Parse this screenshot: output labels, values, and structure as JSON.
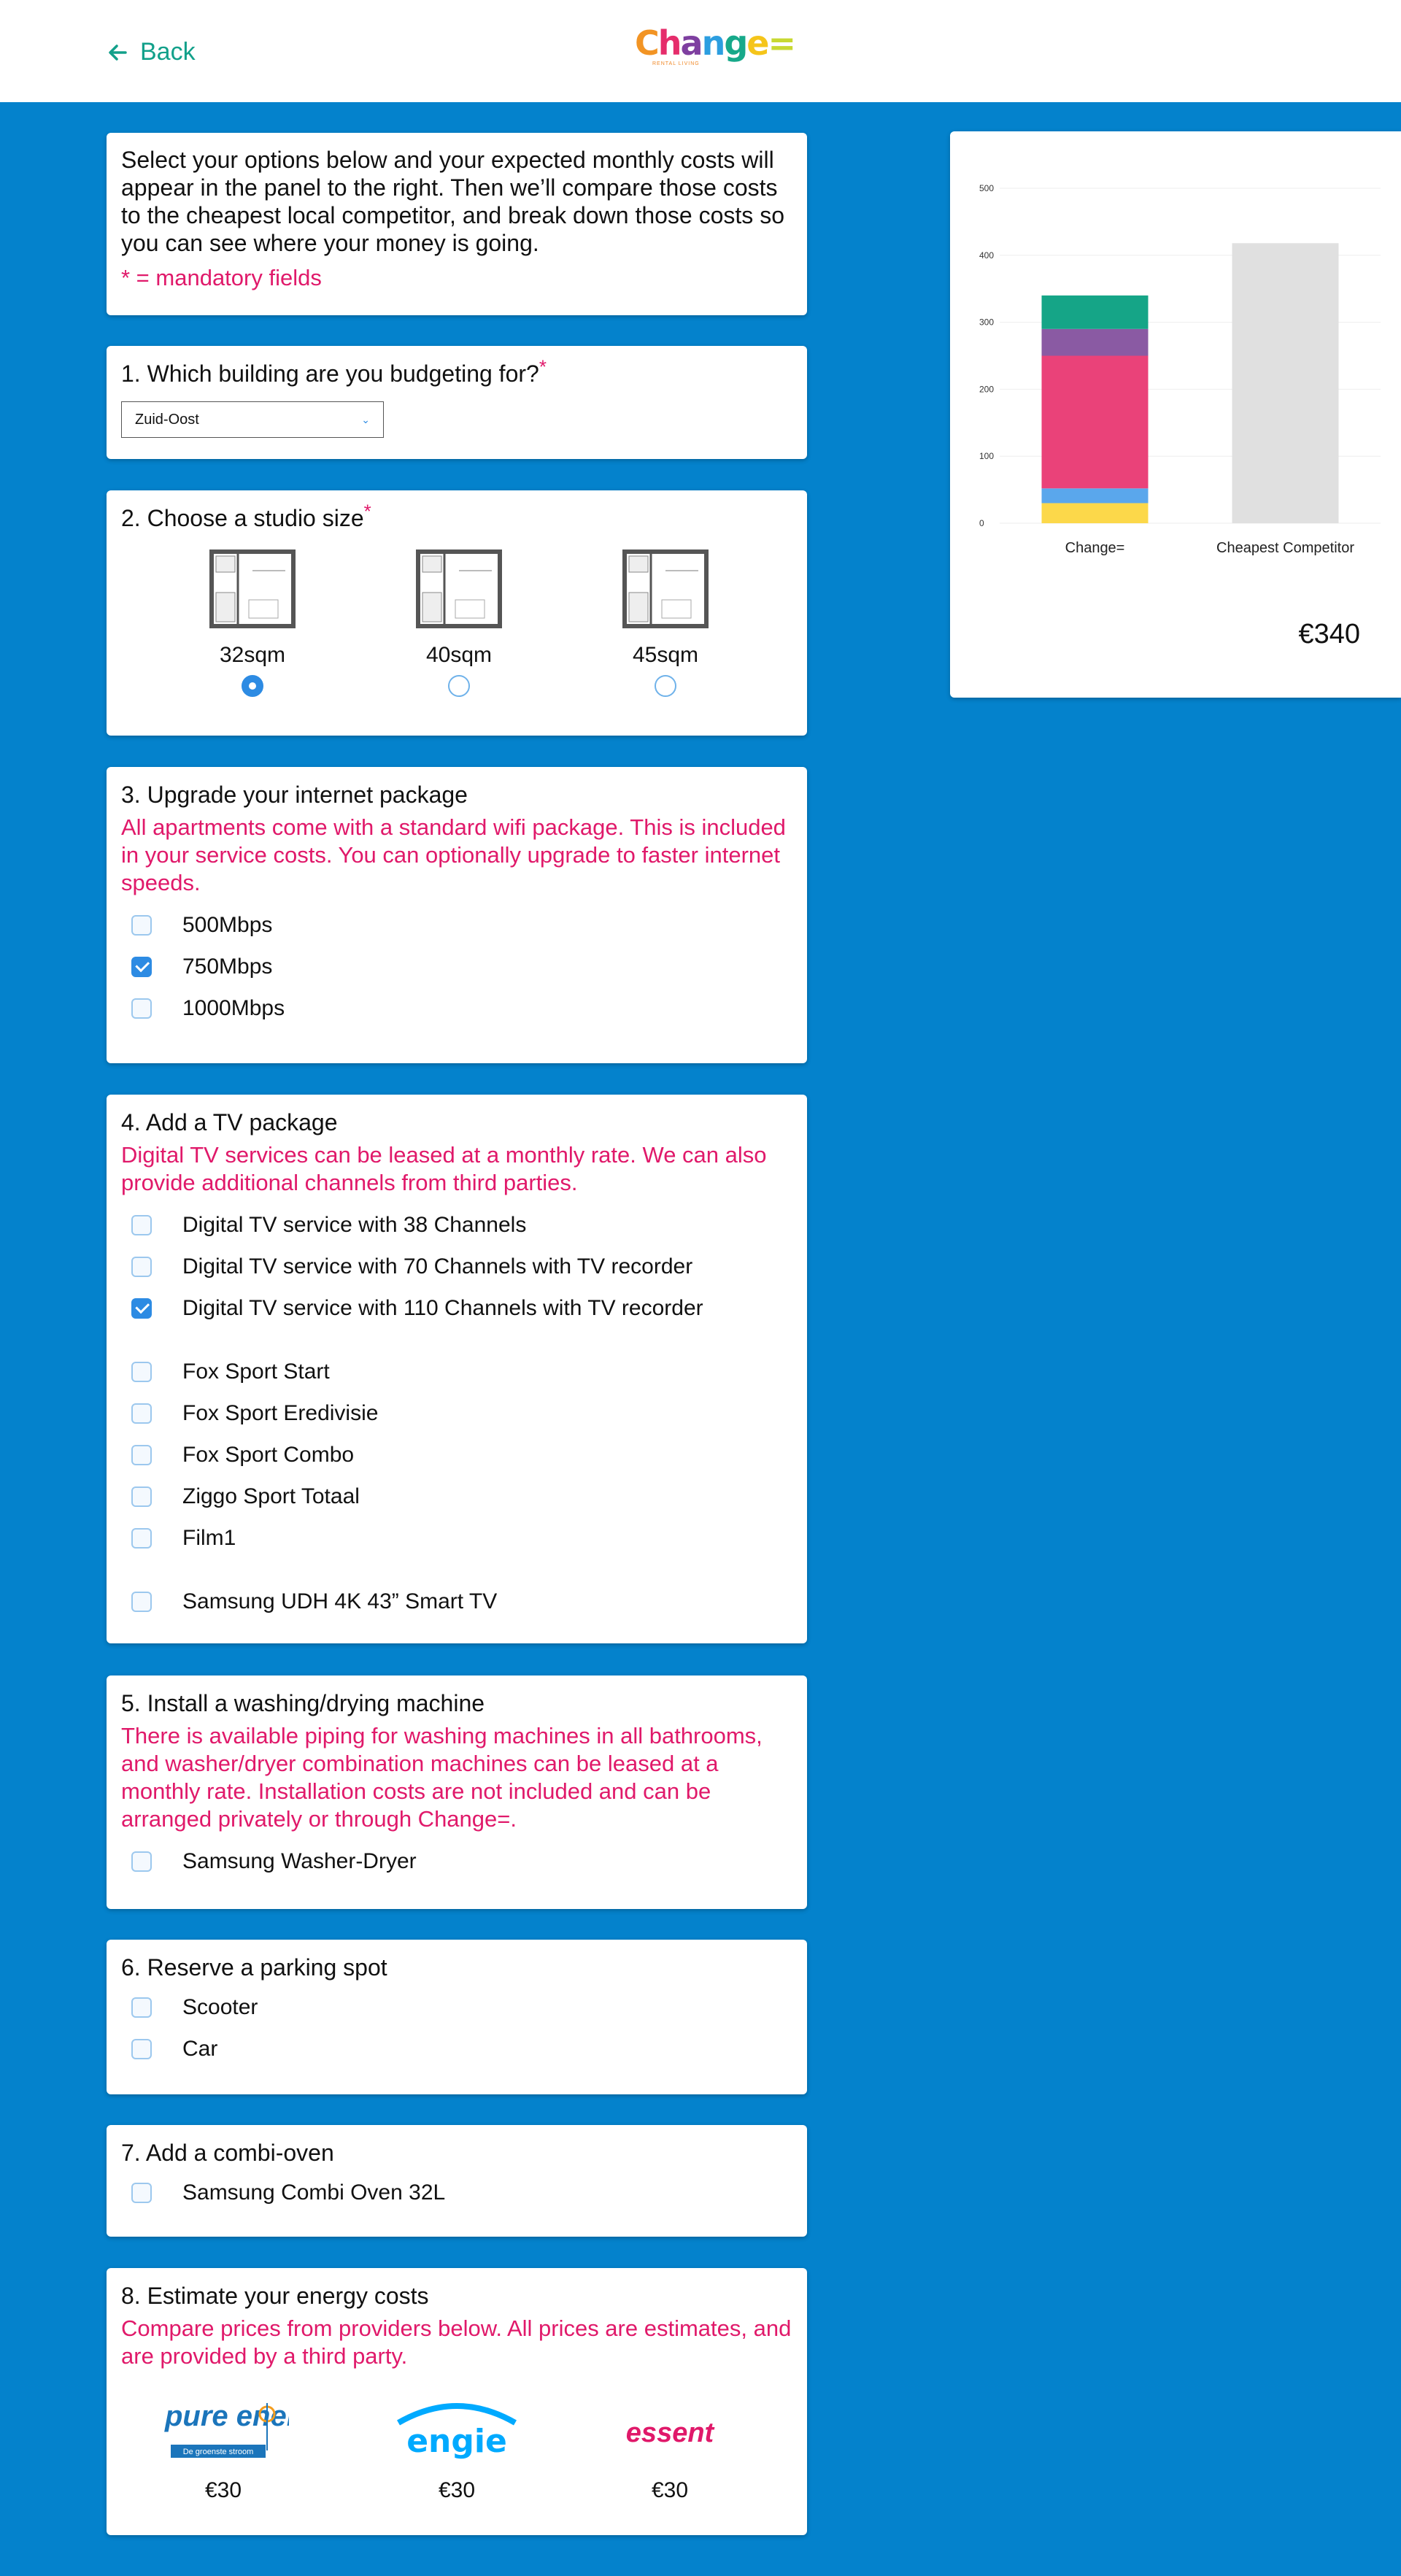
{
  "header": {
    "back_label": "Back",
    "logo_text": "Change=",
    "logo_subtitle": "RENTAL LIVING"
  },
  "intro": {
    "text": "Select your options below and your expected monthly costs will appear in the panel to the right. Then we’ll compare those costs to the cheapest local competitor, and break down those costs so you can see where your money is going.",
    "mandatory": "* = mandatory fields"
  },
  "q1": {
    "title": "1. Which building are you budgeting for?",
    "required": "*",
    "selected": "Zuid-Oost"
  },
  "q2": {
    "title": "2. Choose a studio size",
    "required": "*",
    "options": [
      {
        "label": "32sqm",
        "selected": true
      },
      {
        "label": "40sqm",
        "selected": false
      },
      {
        "label": "45sqm",
        "selected": false
      }
    ]
  },
  "q3": {
    "title": "3. Upgrade your internet package",
    "note": "All apartments come with a standard wifi package. This is included in your service costs. You can optionally upgrade to faster internet speeds.",
    "options": [
      {
        "label": "500Mbps",
        "checked": false
      },
      {
        "label": "750Mbps",
        "checked": true
      },
      {
        "label": "1000Mbps",
        "checked": false
      }
    ]
  },
  "q4": {
    "title": "4. Add a TV package",
    "note": "Digital TV services can be leased at a monthly rate. We can also provide additional channels from third parties.",
    "group1": [
      {
        "label": "Digital TV service with 38 Channels",
        "checked": false
      },
      {
        "label": "Digital TV service with 70 Channels with TV recorder",
        "checked": false
      },
      {
        "label": "Digital TV service with 110 Channels with TV recorder",
        "checked": true
      }
    ],
    "group2": [
      {
        "label": "Fox Sport Start",
        "checked": false
      },
      {
        "label": "Fox Sport Eredivisie",
        "checked": false
      },
      {
        "label": "Fox Sport Combo",
        "checked": false
      },
      {
        "label": "Ziggo Sport Totaal",
        "checked": false
      },
      {
        "label": "Film1",
        "checked": false
      }
    ],
    "group3": [
      {
        "label": "Samsung UDH 4K 43” Smart TV",
        "checked": false
      }
    ]
  },
  "q5": {
    "title": "5. Install a washing/drying machine",
    "note": "There is available piping for washing machines in all bathrooms, and washer/dryer combination machines can be leased at a monthly rate. Installation costs are not included and can be arranged privately or through Change=.",
    "options": [
      {
        "label": "Samsung Washer-Dryer",
        "checked": false
      }
    ]
  },
  "q6": {
    "title": "6. Reserve a parking spot",
    "options": [
      {
        "label": "Scooter",
        "checked": false
      },
      {
        "label": "Car",
        "checked": false
      }
    ]
  },
  "q7": {
    "title": "7. Add a combi-oven",
    "options": [
      {
        "label": "Samsung Combi Oven 32L",
        "checked": false
      }
    ]
  },
  "q8": {
    "title": "8. Estimate your energy costs",
    "note": "Compare prices from providers below. All prices are estimates, and are provided by a third party.",
    "providers": [
      {
        "name": "pure energie",
        "tagline": "De groenste stroom",
        "price": "€30"
      },
      {
        "name": "engie",
        "price": "€30"
      },
      {
        "name": "essent",
        "price": "€30"
      }
    ]
  },
  "summary": {
    "total": "€340"
  },
  "colors": {
    "background": "#0482cc",
    "accent": "#2d8be3",
    "mandatory": "#e0196a",
    "back": "#12a08a",
    "seg_teal": "#15a587",
    "seg_purple": "#8a5aa3",
    "seg_pink": "#ea4279",
    "seg_blue": "#5aa7ec",
    "seg_yellow": "#fcd84a",
    "competitor": "#e0e0e0"
  },
  "chart_data": {
    "type": "bar",
    "stacked": true,
    "categories": [
      "Change=",
      "Cheapest Competitor"
    ],
    "ylim": [
      0,
      500
    ],
    "yticks": [
      0,
      100,
      200,
      300,
      400,
      500
    ],
    "grid": true,
    "stacks": [
      {
        "category": "Change=",
        "segments": [
          {
            "value": 30,
            "color": "#fcd84a"
          },
          {
            "value": 22,
            "color": "#5aa7ec"
          },
          {
            "value": 198,
            "color": "#ea4279"
          },
          {
            "value": 40,
            "color": "#8a5aa3"
          },
          {
            "value": 50,
            "color": "#15a587"
          }
        ]
      },
      {
        "category": "Cheapest Competitor",
        "segments": [
          {
            "value": 418,
            "color": "#e0e0e0"
          }
        ]
      }
    ]
  }
}
